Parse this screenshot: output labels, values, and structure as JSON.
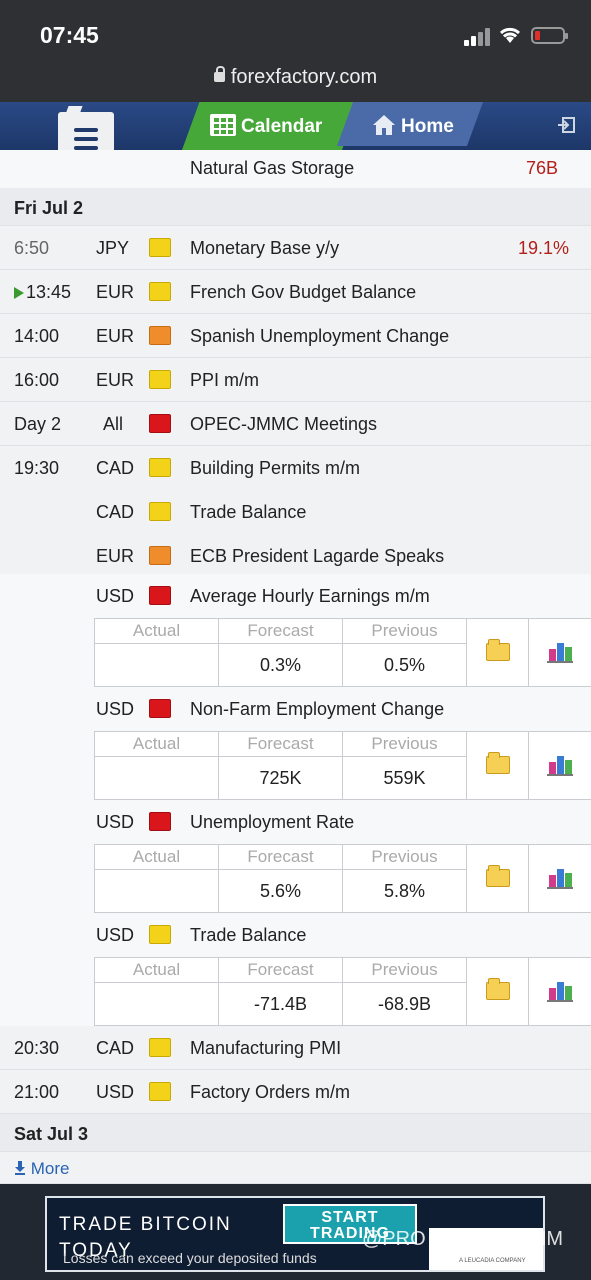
{
  "status_bar": {
    "time": "07:45"
  },
  "browser": {
    "url": "forexfactory.com"
  },
  "nav": {
    "calendar_label": "Calendar",
    "home_label": "Home"
  },
  "carryover_event": {
    "name": "Natural Gas Storage",
    "actual": "76B"
  },
  "days": [
    {
      "date": "Fri Jul 2"
    },
    {
      "date": "Sat Jul 3"
    }
  ],
  "rows": [
    {
      "time": "6:50",
      "currency": "JPY",
      "impact": "low",
      "event": "Monetary Base y/y",
      "actual": "19.1%"
    },
    {
      "time": "13:45",
      "currency": "EUR",
      "impact": "low",
      "event": "French Gov Budget Balance",
      "actual": ""
    },
    {
      "time": "14:00",
      "currency": "EUR",
      "impact": "medium",
      "event": "Spanish Unemployment Change",
      "actual": ""
    },
    {
      "time": "16:00",
      "currency": "EUR",
      "impact": "low",
      "event": "PPI m/m",
      "actual": ""
    },
    {
      "time": "Day 2",
      "currency": "All",
      "impact": "high",
      "event": "OPEC-JMMC Meetings",
      "actual": ""
    },
    {
      "time": "19:30",
      "currency": "CAD",
      "impact": "low",
      "event": "Building Permits m/m",
      "actual": ""
    },
    {
      "time": "",
      "currency": "CAD",
      "impact": "low",
      "event": "Trade Balance",
      "actual": ""
    },
    {
      "time": "",
      "currency": "EUR",
      "impact": "medium",
      "event": "ECB President Lagarde Speaks",
      "actual": ""
    }
  ],
  "detail_headers": {
    "actual": "Actual",
    "forecast": "Forecast",
    "previous": "Previous"
  },
  "expanded_events": [
    {
      "currency": "USD",
      "impact": "high",
      "event": "Average Hourly Earnings m/m",
      "actual": "",
      "forecast": "0.3%",
      "previous": "0.5%"
    },
    {
      "currency": "USD",
      "impact": "high",
      "event": "Non-Farm Employment Change",
      "actual": "",
      "forecast": "725K",
      "previous": "559K"
    },
    {
      "currency": "USD",
      "impact": "high",
      "event": "Unemployment Rate",
      "actual": "",
      "forecast": "5.6%",
      "previous": "5.8%"
    },
    {
      "currency": "USD",
      "impact": "low",
      "event": "Trade Balance",
      "actual": "",
      "forecast": "-71.4B",
      "previous": "-68.9B"
    }
  ],
  "later_rows": [
    {
      "time": "20:30",
      "currency": "CAD",
      "impact": "low",
      "event": "Manufacturing PMI"
    },
    {
      "time": "21:00",
      "currency": "USD",
      "impact": "low",
      "event": "Factory Orders m/m"
    }
  ],
  "more_label": "More",
  "ad": {
    "title": "TRADE BITCOIN TODAY",
    "button": "START TRADING",
    "warning": "Losses can exceed your deposited funds",
    "sponsor_tag": "A LEUCADIA COMPANY"
  },
  "watermark": "@PRO TRADER VNM",
  "colors": {
    "nav_blue": "#1f3a6b",
    "nav_green": "#47a83a",
    "actual_red": "#b3201b",
    "impact_low": "#f3d21a",
    "impact_medium": "#ef8c2b",
    "impact_high": "#d8161b"
  }
}
